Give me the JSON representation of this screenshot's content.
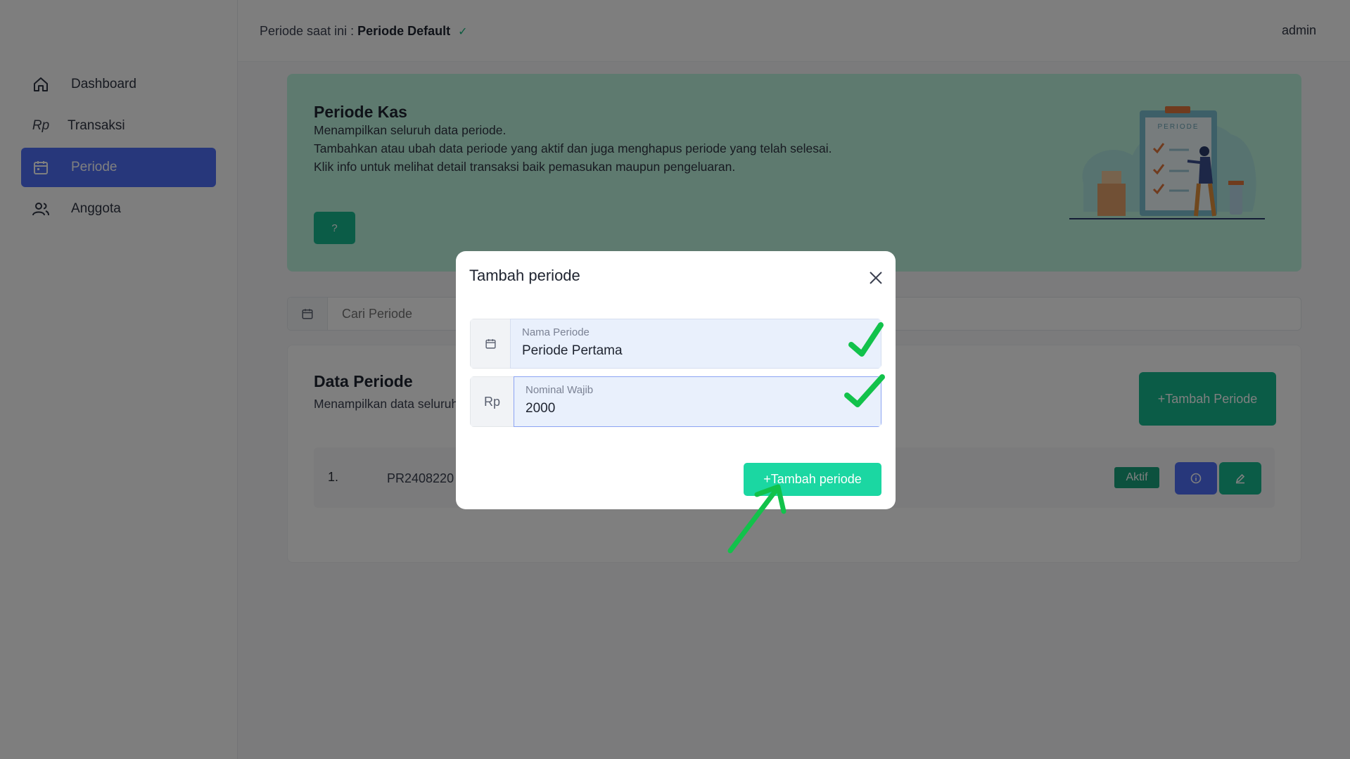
{
  "topbar": {
    "period_prefix": "Periode saat ini :",
    "period_name": "Periode Default",
    "user": "admin"
  },
  "sidebar": {
    "items": [
      {
        "label": "Dashboard",
        "icon": "home-icon"
      },
      {
        "label": "Transaksi",
        "icon": "rp-icon",
        "icon_text": "Rp"
      },
      {
        "label": "Periode",
        "icon": "calendar-icon",
        "active": true
      },
      {
        "label": "Anggota",
        "icon": "users-icon"
      }
    ]
  },
  "hero": {
    "title": "Periode Kas",
    "lines": [
      "Menampilkan seluruh data periode.",
      "Tambahkan atau ubah data periode yang aktif dan juga menghapus periode yang telah selesai.",
      "Klik info untuk melihat detail transaksi baik pemasukan maupun pengeluaran."
    ],
    "help_label": "?",
    "illustration_text": "PERIODE"
  },
  "search": {
    "placeholder": "Cari Periode"
  },
  "data_card": {
    "title": "Data Periode",
    "subtitle": "Menampilkan data seluruh periode.",
    "add_button": "+Tambah Periode",
    "rows": [
      {
        "no": "1.",
        "code": "PR2408220",
        "status": "Aktif"
      }
    ]
  },
  "modal": {
    "title": "Tambah periode",
    "fields": {
      "name": {
        "label": "Nama Periode",
        "value": "Periode Pertama"
      },
      "nominal": {
        "addon": "Rp",
        "label": "Nominal Wajib",
        "value": "2000"
      }
    },
    "submit_label": "+Tambah periode"
  },
  "colors": {
    "primary": "#4f6ef7",
    "accent": "#17b98f",
    "annotation": "#12c24b"
  }
}
